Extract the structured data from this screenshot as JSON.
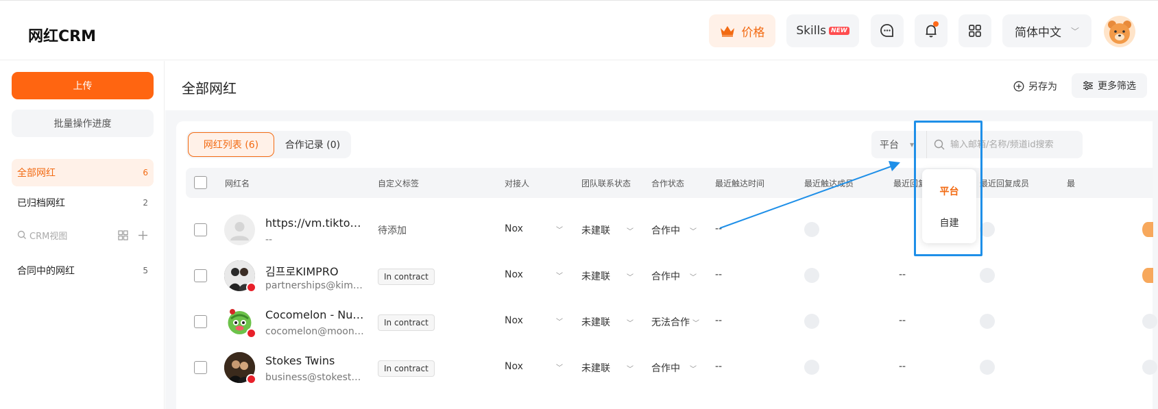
{
  "topbar": {
    "brand": "网红CRM",
    "price_label": "价格",
    "skills_label": "Skills",
    "skills_badge": "NEW",
    "language": "简体中文"
  },
  "sidebar": {
    "upload_label": "上传",
    "batch_label": "批量操作进度",
    "items": [
      {
        "label": "全部网红",
        "count": "6"
      },
      {
        "label": "已归档网红",
        "count": "2"
      }
    ],
    "crm_view_label": "CRM视图",
    "views": [
      {
        "label": "合同中的网红",
        "count": "5"
      }
    ]
  },
  "main": {
    "title": "全部网红",
    "save_as": "另存为",
    "more_filter": "更多筛选",
    "tabs": [
      {
        "label": "网红列表 (6)"
      },
      {
        "label": "合作记录 (0)"
      }
    ],
    "platform_select": "平台",
    "search_placeholder": "输入邮箱/名称/频道id搜索"
  },
  "table": {
    "headers": [
      "网红名",
      "自定义标签",
      "对接人",
      "团队联系状态",
      "合作状态",
      "最近触达时间",
      "最近触达成员",
      "最近回复时间",
      "最近回复成员",
      "最"
    ],
    "rows": [
      {
        "name": "https://vm.tiktok.com/ZMS",
        "email": "--",
        "tag": "待添加",
        "contact": "Nox",
        "team_status": "未建联",
        "coop_status": "合作中",
        "last_touch": "--",
        "last_reply_time": ""
      },
      {
        "name": "김프로KIMPRO",
        "email": "partnerships@kimpro.kr",
        "tag": "In contract",
        "contact": "Nox",
        "team_status": "未建联",
        "coop_status": "合作中",
        "last_touch": "--",
        "last_reply_time": "--"
      },
      {
        "name": "Cocomelon - Nursery Rhymes",
        "email": "cocomelon@moonbug.com",
        "tag": "In contract",
        "contact": "Nox",
        "team_status": "未建联",
        "coop_status": "无法合作",
        "last_touch": "--",
        "last_reply_time": "--"
      },
      {
        "name": "Stokes Twins",
        "email": "business@stokestwins.com",
        "tag": "In contract",
        "contact": "Nox",
        "team_status": "未建联",
        "coop_status": "合作中",
        "last_touch": "--",
        "last_reply_time": "--"
      }
    ]
  },
  "dropdown": {
    "options": [
      "平台",
      "自建"
    ],
    "selected": "平台"
  },
  "colors": {
    "accent": "#ff6511",
    "annotation": "#1e8fe8"
  }
}
